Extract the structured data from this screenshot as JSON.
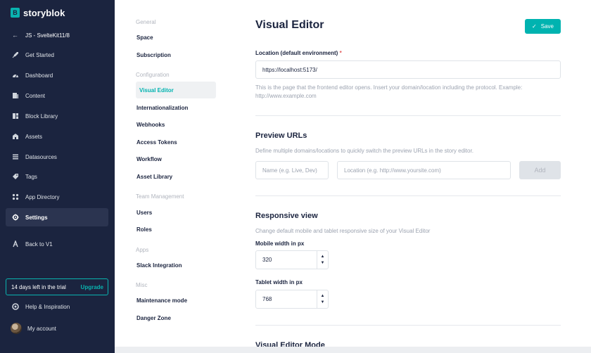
{
  "brand": {
    "logo_letter": "B",
    "name": "storyblok"
  },
  "sidebar": {
    "space": "JS - SvelteKit11/8",
    "items": [
      {
        "label": "Get Started",
        "icon": "rocket-icon"
      },
      {
        "label": "Dashboard",
        "icon": "gauge-icon"
      },
      {
        "label": "Content",
        "icon": "content-icon"
      },
      {
        "label": "Block Library",
        "icon": "blocks-icon"
      },
      {
        "label": "Assets",
        "icon": "assets-icon"
      },
      {
        "label": "Datasources",
        "icon": "datasources-icon"
      },
      {
        "label": "Tags",
        "icon": "tag-icon"
      },
      {
        "label": "App Directory",
        "icon": "apps-icon"
      },
      {
        "label": "Settings",
        "icon": "gear-icon",
        "active": true
      },
      {
        "label": "Back to V1",
        "icon": "back-v1-icon"
      }
    ],
    "trial_text": "14 days left in the trial",
    "upgrade_label": "Upgrade",
    "help_label": "Help & Inspiration",
    "account_label": "My account"
  },
  "subnav": {
    "groups": [
      {
        "heading": "General",
        "items": [
          "Space",
          "Subscription"
        ]
      },
      {
        "heading": "Configuration",
        "items": [
          "Visual Editor",
          "Internationalization",
          "Webhooks",
          "Access Tokens",
          "Workflow",
          "Asset Library"
        ]
      },
      {
        "heading": "Team Management",
        "items": [
          "Users",
          "Roles"
        ]
      },
      {
        "heading": "Apps",
        "items": [
          "Slack Integration"
        ]
      },
      {
        "heading": "Misc",
        "items": [
          "Maintenance mode",
          "Danger Zone"
        ]
      }
    ],
    "active": "Visual Editor"
  },
  "main": {
    "title": "Visual Editor",
    "save_label": "Save",
    "location": {
      "label": "Location (default environment)",
      "required_mark": "*",
      "value": "https://localhost:5173/",
      "help_line1": "This is the page that the frontend editor opens. Insert your domain/location including the protocol. Example:",
      "help_line2": "http://www.example.com"
    },
    "preview": {
      "title": "Preview URLs",
      "help": "Define multiple domains/locations to quickly switch the preview URLs in the story editor.",
      "name_placeholder": "Name (e.g. Live, Dev)",
      "location_placeholder": "Location (e.g. http://www.yoursite.com)",
      "add_label": "Add"
    },
    "responsive": {
      "title": "Responsive view",
      "help": "Change default mobile and tablet responsive size of your Visual Editor",
      "mobile_label": "Mobile width in px",
      "mobile_value": "320",
      "tablet_label": "Tablet width in px",
      "tablet_value": "768"
    },
    "next_section_title": "Visual Editor Mode"
  }
}
